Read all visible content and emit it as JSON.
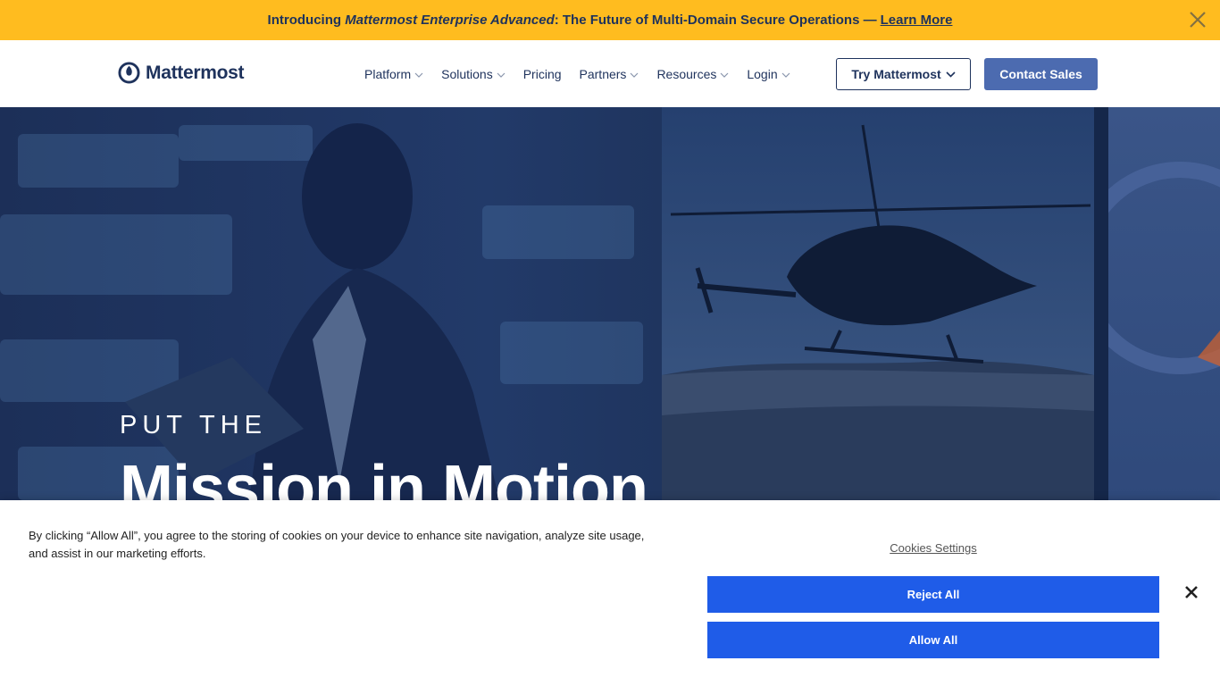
{
  "announcement": {
    "prefix": "Introducing ",
    "product": "Mattermost Enterprise Advanced",
    "suffix": ": The Future of Multi-Domain Secure Operations —",
    "link": "Learn More",
    "close_icon": "close-icon"
  },
  "header": {
    "brand": "Mattermost",
    "nav": [
      {
        "label": "Platform",
        "has_dropdown": true
      },
      {
        "label": "Solutions",
        "has_dropdown": true
      },
      {
        "label": "Pricing",
        "has_dropdown": false
      },
      {
        "label": "Partners",
        "has_dropdown": true
      },
      {
        "label": "Resources",
        "has_dropdown": true
      },
      {
        "label": "Login",
        "has_dropdown": true
      }
    ],
    "try_label": "Try Mattermost",
    "contact_label": "Contact Sales"
  },
  "hero": {
    "eyebrow": "PUT THE",
    "headline": "Mission in Motion"
  },
  "cookie_banner": {
    "message": "By clicking “Allow All”, you agree to the storing of cookies on your device to enhance site navigation, analyze site usage, and assist in our marketing efforts.",
    "settings_label": "Cookies Settings",
    "reject_label": "Reject All",
    "allow_label": "Allow All"
  },
  "colors": {
    "announcement_bg": "#ffbc1f",
    "brand_navy": "#1e325c",
    "contact_button": "#4c6bb0",
    "cookie_button": "#1f5ce8"
  }
}
